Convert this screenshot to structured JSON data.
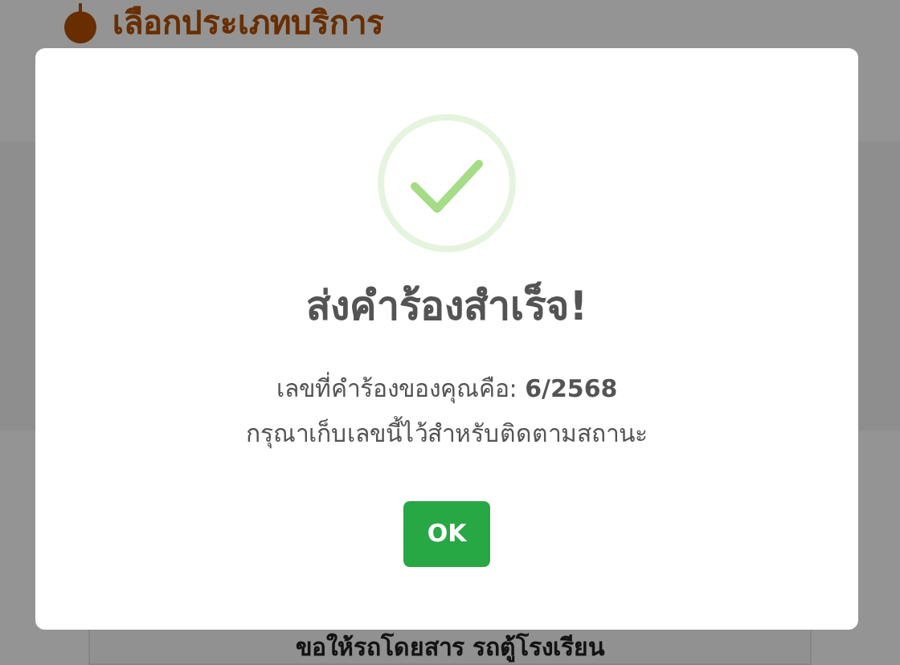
{
  "background_page": {
    "heading": "เลือกประเภทบริการ",
    "service_card": {
      "title": "ขอให้รถโดยสาร รถตู้โรงเรียน"
    }
  },
  "dialog": {
    "kind": "success",
    "title": "ส่งคำร้องสำเร็จ!",
    "message": "เลขที่คำร้องของคุณคือ: **6/2568**",
    "note": "กรุณาเก็บเลขนี้ไว้สำหรับติดตามสถานะ",
    "button": "OK"
  }
}
